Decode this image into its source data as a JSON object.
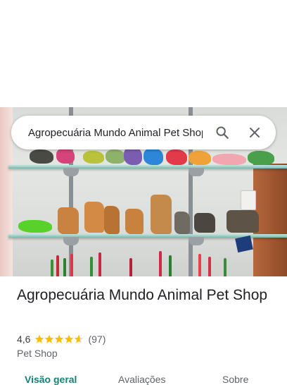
{
  "search": {
    "value": "Agropecuária Mundo Animal Pet Shop",
    "search_icon": "search-icon",
    "close_icon": "close-icon"
  },
  "photo": {
    "icon": "place-photo"
  },
  "place": {
    "name": "Agropecuária Mundo Animal Pet Shop",
    "rating": "4,6",
    "rating_value": 4.6,
    "stars_max": 5,
    "reviews": "(97)",
    "category": "Pet Shop"
  },
  "tabs": [
    {
      "label": "Visão geral",
      "active": true
    },
    {
      "label": "Avaliações",
      "active": false
    },
    {
      "label": "Sobre",
      "active": false
    }
  ],
  "colors": {
    "accent": "#188074",
    "star": "#fbbc04",
    "star_empty": "#dadce0",
    "text": "#202124",
    "secondary": "#5f6368"
  }
}
